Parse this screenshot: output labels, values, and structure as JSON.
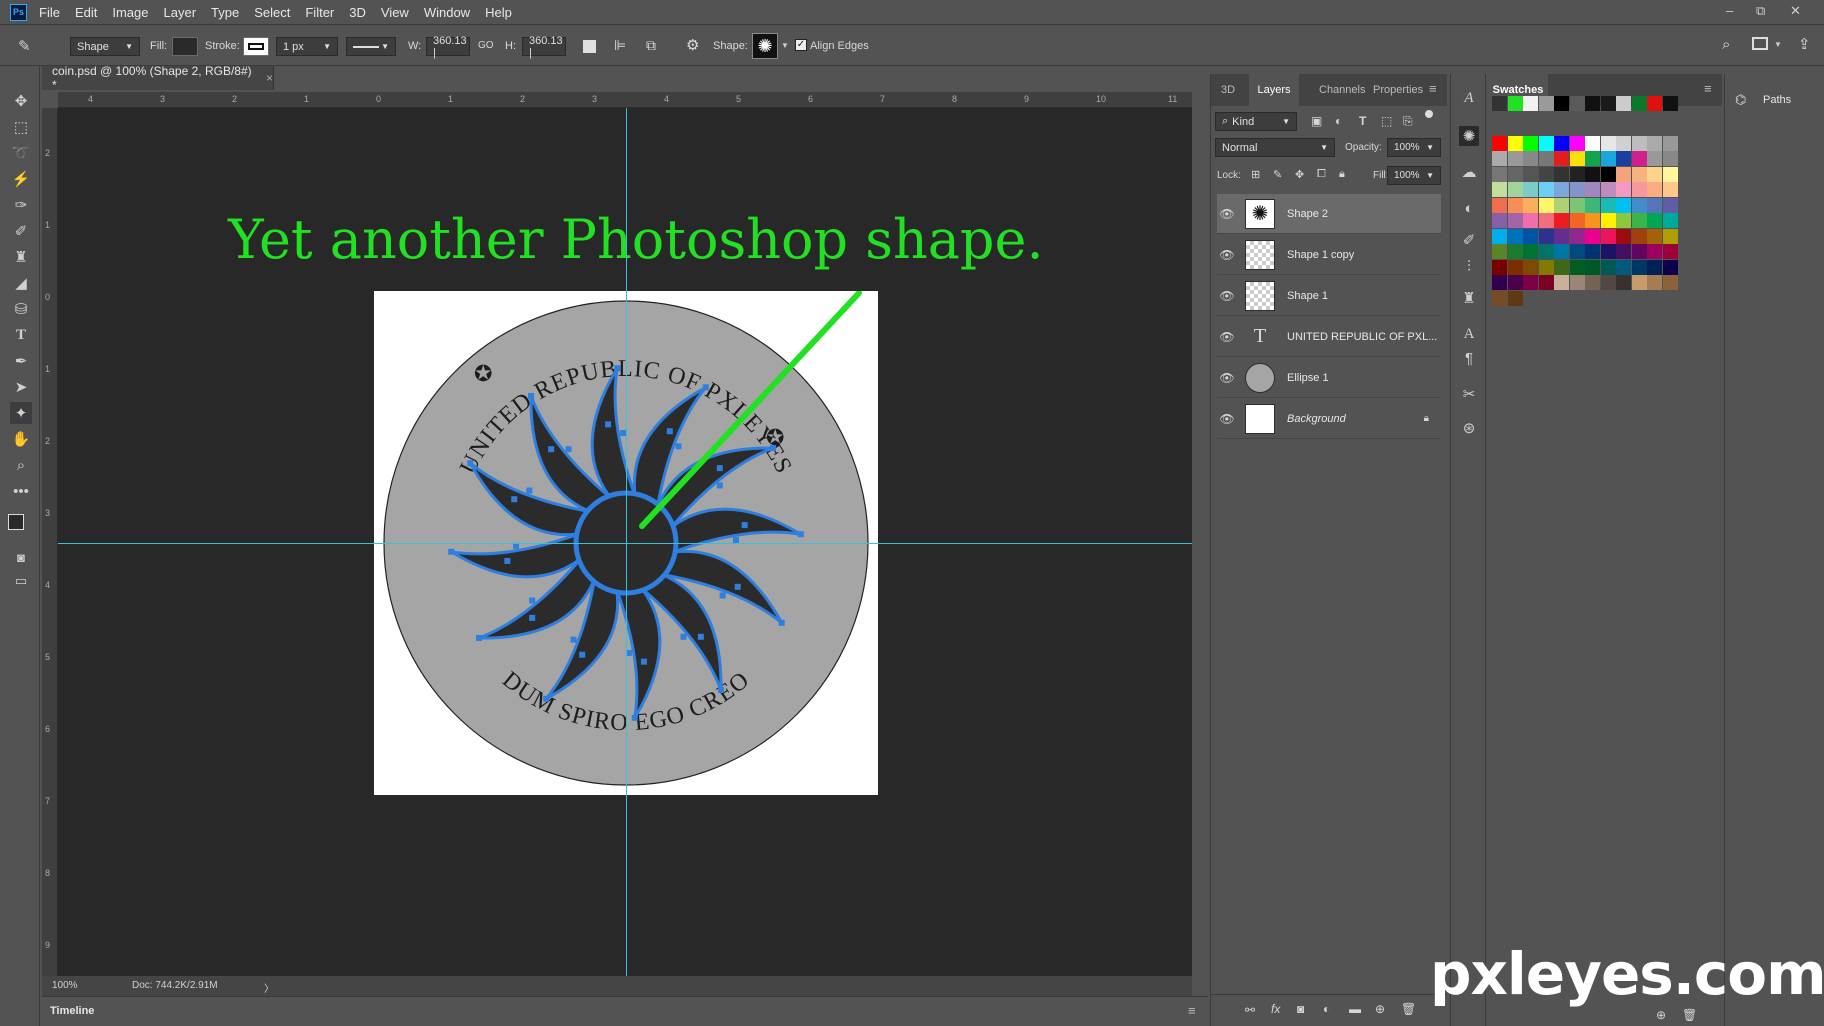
{
  "app": {
    "logo": "Ps"
  },
  "menu": [
    "File",
    "Edit",
    "Image",
    "Layer",
    "Type",
    "Select",
    "Filter",
    "3D",
    "View",
    "Window",
    "Help"
  ],
  "window_controls": {
    "minimize": "–",
    "restore": "⧉",
    "close": "✕"
  },
  "options": {
    "tool_mode": "Shape",
    "fill_label": "Fill:",
    "stroke_label": "Stroke:",
    "stroke_width": "1 px",
    "w_label": "W:",
    "w_value": "360.13 |",
    "link_icon": "GO",
    "h_label": "H:",
    "h_value": "360.13 |",
    "shape_label": "Shape:",
    "align_edges": "Align Edges"
  },
  "document": {
    "tab_title": "coin.psd @ 100% (Shape 2, RGB/8#) *",
    "tab_close": "×",
    "headline": "Yet another Photoshop shape.",
    "coin_top_text": "UNITED REPUBLIC OF PXLEYES",
    "coin_bottom_text": "DUM SPIRO EGO CREO",
    "zoom": "100%",
    "doc_info": "Doc: 744.2K/2.91M",
    "status_arrow": "〉",
    "ruler_top": [
      "4",
      "3",
      "2",
      "1",
      "0",
      "1",
      "2",
      "3",
      "4",
      "5",
      "6",
      "7",
      "8",
      "9",
      "10",
      "11"
    ],
    "ruler_left": [
      "2",
      "1",
      "0",
      "1",
      "2",
      "3",
      "4",
      "5",
      "6",
      "7",
      "8",
      "9"
    ]
  },
  "timeline": {
    "label": "Timeline"
  },
  "layers_panel": {
    "tabs": [
      "3D",
      "Layers",
      "Channels",
      "Properties"
    ],
    "filter_kind": "Kind",
    "blend_mode": "Normal",
    "opacity_label": "Opacity:",
    "opacity_value": "100%",
    "lock_label": "Lock:",
    "fill_label": "Fill:",
    "fill_value": "100%",
    "layers": [
      {
        "name": "Shape 2",
        "type": "shape",
        "selected": true
      },
      {
        "name": "Shape 1 copy",
        "type": "transparent",
        "selected": false
      },
      {
        "name": "Shape 1",
        "type": "transparent",
        "selected": false
      },
      {
        "name": "UNITED REPUBLIC OF PXL...",
        "type": "text",
        "selected": false
      },
      {
        "name": "Ellipse 1",
        "type": "ellipse",
        "selected": false
      },
      {
        "name": "Background",
        "type": "background",
        "selected": false
      }
    ]
  },
  "swatches_panel": {
    "title": "Swatches"
  },
  "paths_panel": {
    "title": "Paths"
  },
  "watermark": "pxleyes.com",
  "colors": {
    "headline_green": "#22e022",
    "guide_cyan": "#37c3d6",
    "path_blue": "#2f7fe0",
    "coin_grey": "#a5a5a5",
    "sun_dark": "#2b2b2b"
  }
}
